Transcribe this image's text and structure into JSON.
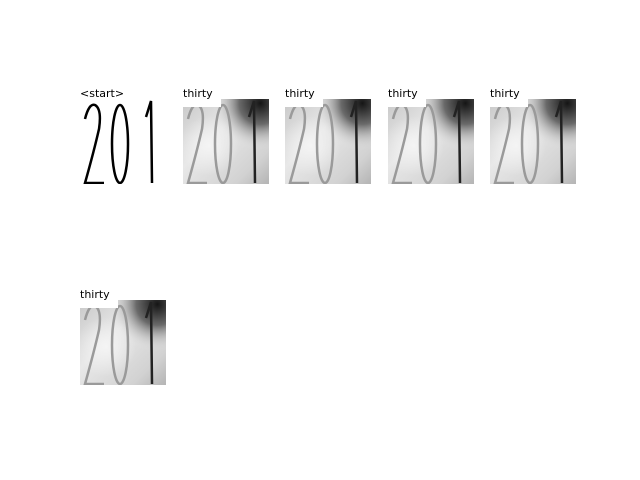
{
  "panels": [
    {
      "label": "<start>",
      "kind": "start"
    },
    {
      "label": "thirty",
      "kind": "attention"
    },
    {
      "label": "thirty",
      "kind": "attention"
    },
    {
      "label": "thirty",
      "kind": "attention"
    },
    {
      "label": "thirty",
      "kind": "attention"
    },
    {
      "label": "thirty",
      "kind": "attention"
    }
  ]
}
